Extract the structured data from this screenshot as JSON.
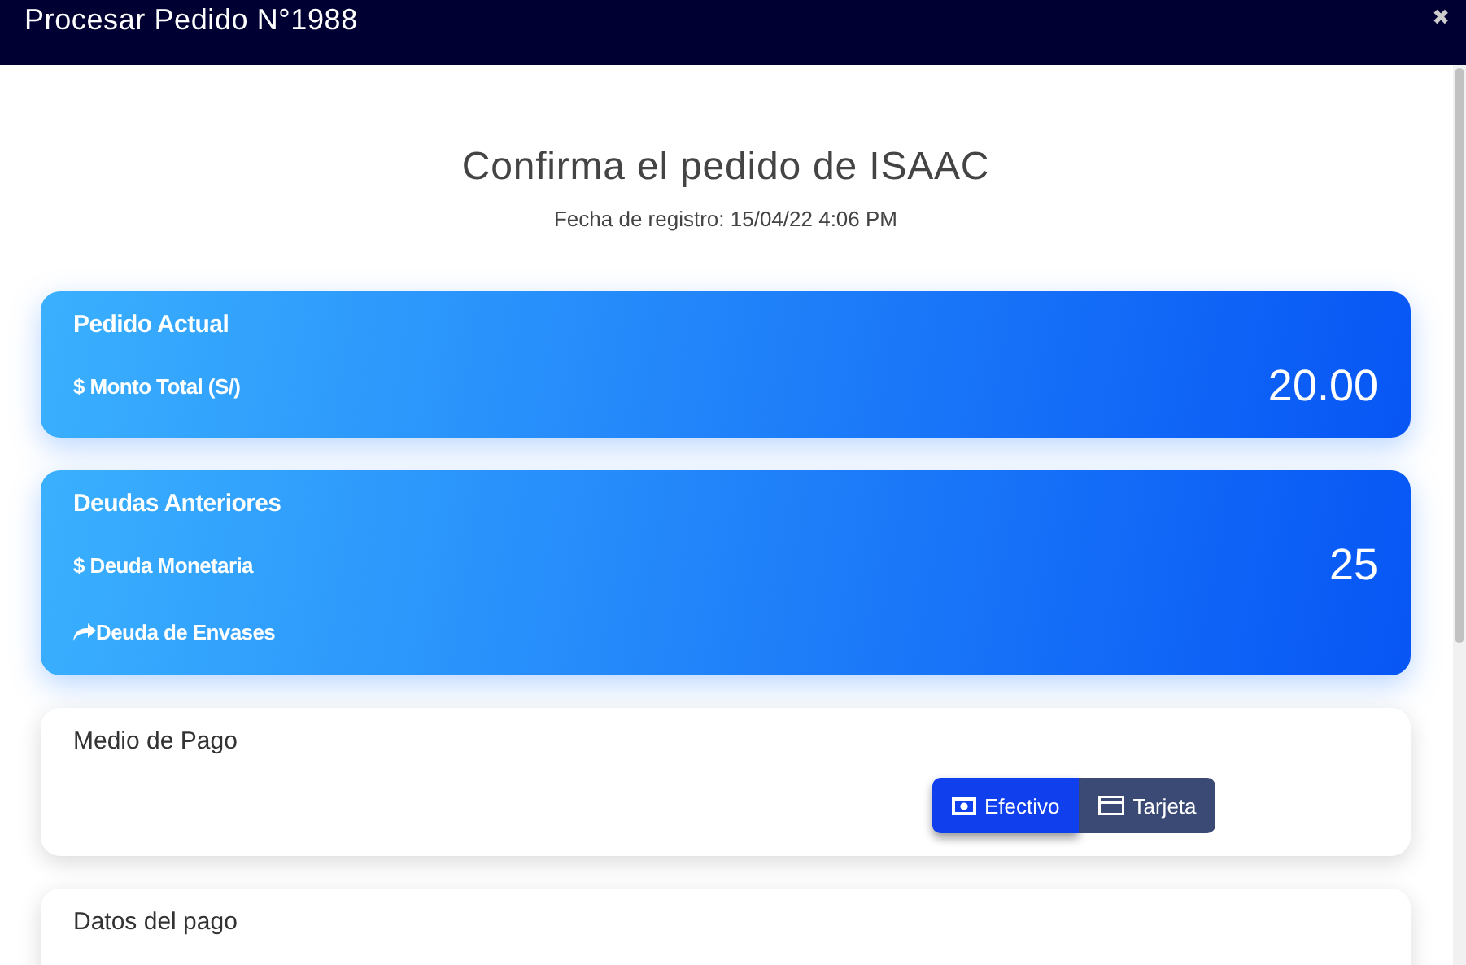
{
  "window": {
    "title": "Procesar Pedido N°1988",
    "close": "✖"
  },
  "heading": "Confirma el pedido de ISAAC",
  "subheading": "Fecha de registro: 15/04/22 4:06 PM",
  "summary_cards": [
    {
      "title": "Pedido Actual",
      "rows": [
        {
          "kind": "money",
          "label": "$ Monto Total (S/)",
          "value": "20.00"
        }
      ]
    },
    {
      "title": "Deudas Anteriores",
      "rows": [
        {
          "kind": "money",
          "label": "$ Deuda Monetaria",
          "value": "25"
        },
        {
          "kind": "containers",
          "label": "Deuda de Envases"
        }
      ]
    }
  ],
  "payment_method": {
    "title": "Medio de Pago",
    "options": [
      {
        "kind": "cash",
        "label": "Efectivo",
        "selected": true
      },
      {
        "kind": "card",
        "label": "Tarjeta",
        "selected": false
      }
    ]
  },
  "payment_data": {
    "title": "Datos del pago"
  }
}
